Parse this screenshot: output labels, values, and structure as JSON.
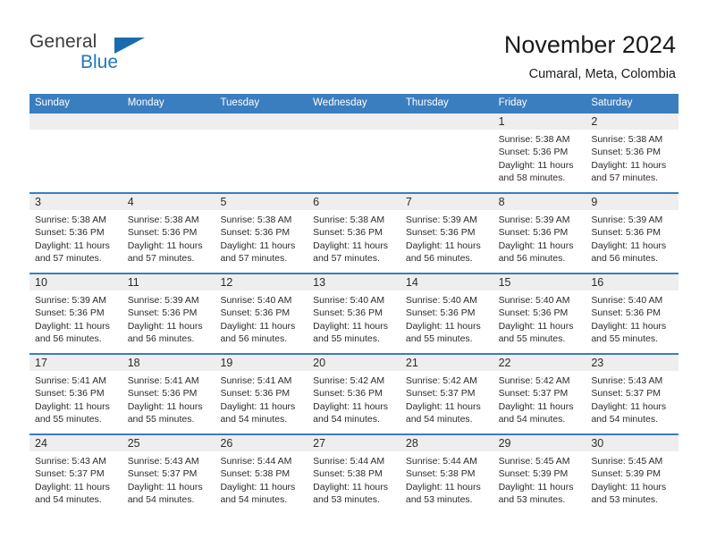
{
  "brand": {
    "name_part1": "General",
    "name_part2": "Blue",
    "accent_color": "#2176bd",
    "triangle_icon": "triangle-icon"
  },
  "header": {
    "title": "November 2024",
    "subtitle": "Cumaral, Meta, Colombia"
  },
  "calendar": {
    "header_bg": "#3a7ebf",
    "daynum_bg": "#eeeeee",
    "weekday_headers": [
      "Sunday",
      "Monday",
      "Tuesday",
      "Wednesday",
      "Thursday",
      "Friday",
      "Saturday"
    ],
    "weeks": [
      [
        {
          "day": "",
          "lines": []
        },
        {
          "day": "",
          "lines": []
        },
        {
          "day": "",
          "lines": []
        },
        {
          "day": "",
          "lines": []
        },
        {
          "day": "",
          "lines": []
        },
        {
          "day": "1",
          "lines": [
            "Sunrise: 5:38 AM",
            "Sunset: 5:36 PM",
            "Daylight: 11 hours",
            "and 58 minutes."
          ]
        },
        {
          "day": "2",
          "lines": [
            "Sunrise: 5:38 AM",
            "Sunset: 5:36 PM",
            "Daylight: 11 hours",
            "and 57 minutes."
          ]
        }
      ],
      [
        {
          "day": "3",
          "lines": [
            "Sunrise: 5:38 AM",
            "Sunset: 5:36 PM",
            "Daylight: 11 hours",
            "and 57 minutes."
          ]
        },
        {
          "day": "4",
          "lines": [
            "Sunrise: 5:38 AM",
            "Sunset: 5:36 PM",
            "Daylight: 11 hours",
            "and 57 minutes."
          ]
        },
        {
          "day": "5",
          "lines": [
            "Sunrise: 5:38 AM",
            "Sunset: 5:36 PM",
            "Daylight: 11 hours",
            "and 57 minutes."
          ]
        },
        {
          "day": "6",
          "lines": [
            "Sunrise: 5:38 AM",
            "Sunset: 5:36 PM",
            "Daylight: 11 hours",
            "and 57 minutes."
          ]
        },
        {
          "day": "7",
          "lines": [
            "Sunrise: 5:39 AM",
            "Sunset: 5:36 PM",
            "Daylight: 11 hours",
            "and 56 minutes."
          ]
        },
        {
          "day": "8",
          "lines": [
            "Sunrise: 5:39 AM",
            "Sunset: 5:36 PM",
            "Daylight: 11 hours",
            "and 56 minutes."
          ]
        },
        {
          "day": "9",
          "lines": [
            "Sunrise: 5:39 AM",
            "Sunset: 5:36 PM",
            "Daylight: 11 hours",
            "and 56 minutes."
          ]
        }
      ],
      [
        {
          "day": "10",
          "lines": [
            "Sunrise: 5:39 AM",
            "Sunset: 5:36 PM",
            "Daylight: 11 hours",
            "and 56 minutes."
          ]
        },
        {
          "day": "11",
          "lines": [
            "Sunrise: 5:39 AM",
            "Sunset: 5:36 PM",
            "Daylight: 11 hours",
            "and 56 minutes."
          ]
        },
        {
          "day": "12",
          "lines": [
            "Sunrise: 5:40 AM",
            "Sunset: 5:36 PM",
            "Daylight: 11 hours",
            "and 56 minutes."
          ]
        },
        {
          "day": "13",
          "lines": [
            "Sunrise: 5:40 AM",
            "Sunset: 5:36 PM",
            "Daylight: 11 hours",
            "and 55 minutes."
          ]
        },
        {
          "day": "14",
          "lines": [
            "Sunrise: 5:40 AM",
            "Sunset: 5:36 PM",
            "Daylight: 11 hours",
            "and 55 minutes."
          ]
        },
        {
          "day": "15",
          "lines": [
            "Sunrise: 5:40 AM",
            "Sunset: 5:36 PM",
            "Daylight: 11 hours",
            "and 55 minutes."
          ]
        },
        {
          "day": "16",
          "lines": [
            "Sunrise: 5:40 AM",
            "Sunset: 5:36 PM",
            "Daylight: 11 hours",
            "and 55 minutes."
          ]
        }
      ],
      [
        {
          "day": "17",
          "lines": [
            "Sunrise: 5:41 AM",
            "Sunset: 5:36 PM",
            "Daylight: 11 hours",
            "and 55 minutes."
          ]
        },
        {
          "day": "18",
          "lines": [
            "Sunrise: 5:41 AM",
            "Sunset: 5:36 PM",
            "Daylight: 11 hours",
            "and 55 minutes."
          ]
        },
        {
          "day": "19",
          "lines": [
            "Sunrise: 5:41 AM",
            "Sunset: 5:36 PM",
            "Daylight: 11 hours",
            "and 54 minutes."
          ]
        },
        {
          "day": "20",
          "lines": [
            "Sunrise: 5:42 AM",
            "Sunset: 5:36 PM",
            "Daylight: 11 hours",
            "and 54 minutes."
          ]
        },
        {
          "day": "21",
          "lines": [
            "Sunrise: 5:42 AM",
            "Sunset: 5:37 PM",
            "Daylight: 11 hours",
            "and 54 minutes."
          ]
        },
        {
          "day": "22",
          "lines": [
            "Sunrise: 5:42 AM",
            "Sunset: 5:37 PM",
            "Daylight: 11 hours",
            "and 54 minutes."
          ]
        },
        {
          "day": "23",
          "lines": [
            "Sunrise: 5:43 AM",
            "Sunset: 5:37 PM",
            "Daylight: 11 hours",
            "and 54 minutes."
          ]
        }
      ],
      [
        {
          "day": "24",
          "lines": [
            "Sunrise: 5:43 AM",
            "Sunset: 5:37 PM",
            "Daylight: 11 hours",
            "and 54 minutes."
          ]
        },
        {
          "day": "25",
          "lines": [
            "Sunrise: 5:43 AM",
            "Sunset: 5:37 PM",
            "Daylight: 11 hours",
            "and 54 minutes."
          ]
        },
        {
          "day": "26",
          "lines": [
            "Sunrise: 5:44 AM",
            "Sunset: 5:38 PM",
            "Daylight: 11 hours",
            "and 54 minutes."
          ]
        },
        {
          "day": "27",
          "lines": [
            "Sunrise: 5:44 AM",
            "Sunset: 5:38 PM",
            "Daylight: 11 hours",
            "and 53 minutes."
          ]
        },
        {
          "day": "28",
          "lines": [
            "Sunrise: 5:44 AM",
            "Sunset: 5:38 PM",
            "Daylight: 11 hours",
            "and 53 minutes."
          ]
        },
        {
          "day": "29",
          "lines": [
            "Sunrise: 5:45 AM",
            "Sunset: 5:39 PM",
            "Daylight: 11 hours",
            "and 53 minutes."
          ]
        },
        {
          "day": "30",
          "lines": [
            "Sunrise: 5:45 AM",
            "Sunset: 5:39 PM",
            "Daylight: 11 hours",
            "and 53 minutes."
          ]
        }
      ]
    ]
  }
}
